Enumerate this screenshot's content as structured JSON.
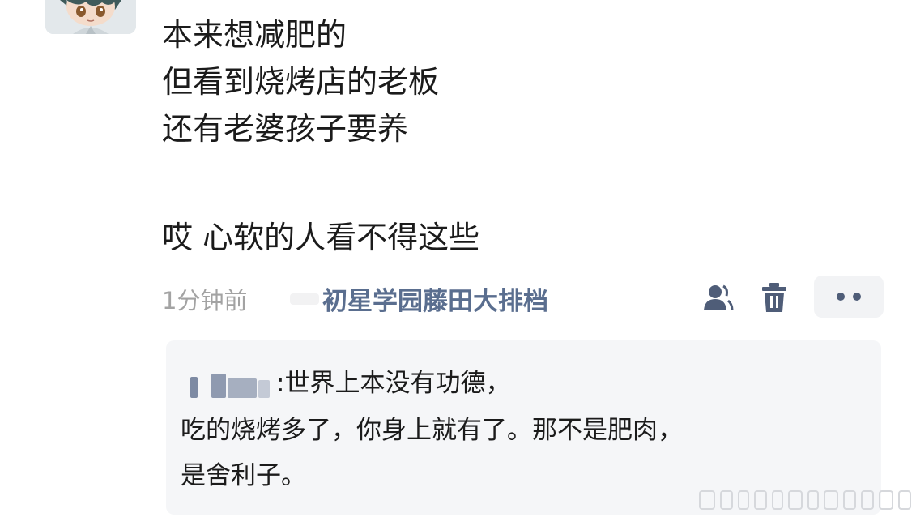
{
  "post": {
    "lines": [
      "本来想减肥的",
      "但看到烧烤店的老板",
      "还有老婆孩子要养",
      "",
      "哎 心软的人看不得这些"
    ]
  },
  "meta": {
    "time": "1分钟前",
    "source": "初星学园藤田大排档"
  },
  "actions": {
    "profile_icon": "person-icon",
    "delete_icon": "trash-icon",
    "more_icon": "more-dots-icon"
  },
  "reply": {
    "separator": ":",
    "line1": "世界上本没有功德，",
    "line2": "吃的烧烤多了，你身上就有了。那不是肥肉，",
    "line3": "是舍利子。"
  },
  "colors": {
    "text": "#1b1b1b",
    "meta_gray": "#a3a3a3",
    "link_blue": "#5a6e8f",
    "reply_bg": "#f5f6f8",
    "icon": "#4f5d78"
  }
}
